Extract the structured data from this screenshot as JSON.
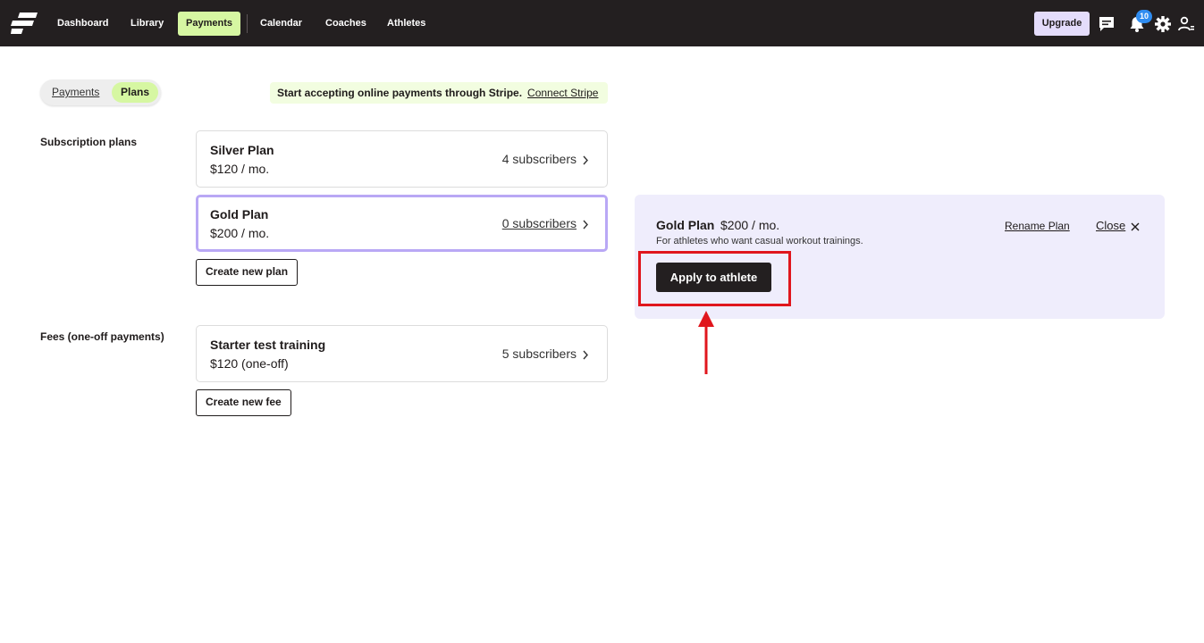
{
  "nav": {
    "items": [
      {
        "label": "Dashboard"
      },
      {
        "label": "Library"
      },
      {
        "label": "Payments"
      },
      {
        "label": "Calendar"
      },
      {
        "label": "Coaches"
      },
      {
        "label": "Athletes"
      }
    ],
    "active_item": "Payments",
    "upgrade_label": "Upgrade",
    "notification_count": "10",
    "icons": [
      "logo-icon",
      "chat-icon",
      "bell-icon",
      "gear-icon",
      "user-icon"
    ]
  },
  "toggle": {
    "options": [
      "Payments",
      "Plans"
    ],
    "selected": "Plans"
  },
  "stripe_banner": {
    "text": "Start accepting online payments through Stripe.",
    "link": "Connect Stripe"
  },
  "subscription_plans": {
    "section_label": "Subscription plans",
    "plans": [
      {
        "name": "Silver Plan",
        "price": "$120 / mo.",
        "subscribers": "4 subscribers"
      },
      {
        "name": "Gold Plan",
        "price": "$200 / mo.",
        "subscribers": "0 subscribers",
        "selected": true
      }
    ],
    "create_label": "Create new plan"
  },
  "fees": {
    "section_label": "Fees (one-off payments)",
    "items": [
      {
        "name": "Starter test training",
        "price": "$120 (one-off)",
        "subscribers": "5 subscribers"
      }
    ],
    "create_label": "Create new fee"
  },
  "detail_panel": {
    "title": "Gold Plan",
    "price": "$200 / mo.",
    "description": "For athletes who want casual workout trainings.",
    "rename_label": "Rename Plan",
    "close_label": "Close",
    "apply_label": "Apply to athlete"
  },
  "colors": {
    "topbar": "#231f20",
    "accent_green": "#d6f7a2",
    "accent_purple": "#b9a8f5",
    "panel_bg": "#efedfc",
    "annotation_red": "#e0161d",
    "badge_blue": "#2f8cf0"
  }
}
